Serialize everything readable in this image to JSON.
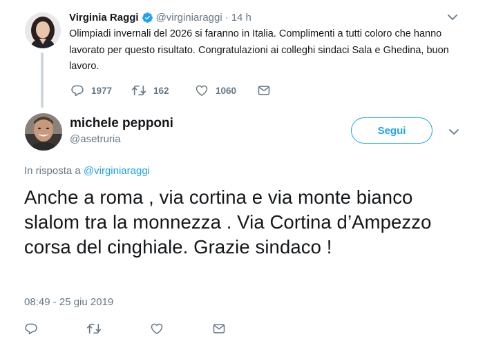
{
  "parent_tweet": {
    "author_name": "Virginia Raggi",
    "handle": "@virginiaraggi",
    "separator": "·",
    "time": "14 h",
    "text": "Olimpiadi invernali del 2026 si faranno in Italia. Complimenti a tutti coloro che hanno lavorato per questo risultato. Congratulazioni ai colleghi sindaci Sala e Ghedina, buon lavoro.",
    "reply_count": "1977",
    "retweet_count": "162",
    "like_count": "1060"
  },
  "main_tweet": {
    "author_name": "michele pepponi",
    "handle": "@asetruria",
    "follow_label": "Segui",
    "reply_prefix": "In risposta a",
    "reply_handle": "@virginiaraggi",
    "text": "Anche a roma , via cortina e via monte bianco slalom tra la monnezza . Via Cortina d’Ampezzo corsa del cinghiale. Grazie sindaco !",
    "timestamp": "08:49 - 25 giu 2019"
  },
  "colors": {
    "accent": "#1da1f2",
    "text_primary": "#14171a",
    "text_secondary": "#657786",
    "thread_line": "#ccd6dd"
  },
  "icons": {
    "verified": "verified-badge-icon",
    "chevron": "chevron-down-icon",
    "reply": "reply-icon",
    "retweet": "retweet-icon",
    "like": "heart-icon",
    "dm": "envelope-icon"
  }
}
